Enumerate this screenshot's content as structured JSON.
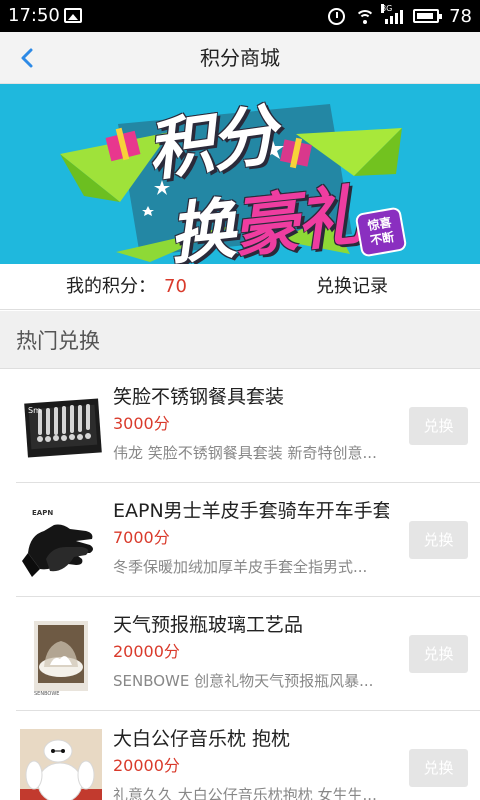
{
  "status_bar": {
    "time": "17:50",
    "signal_tag": "3G",
    "battery_percent": "78"
  },
  "nav": {
    "title": "积分商城"
  },
  "banner": {
    "line1": "积分",
    "line2_a": "换",
    "line2_b": "豪礼",
    "badge_line1": "惊喜",
    "badge_line2": "不断"
  },
  "points": {
    "label": "我的积分：",
    "value": "70",
    "record_link": "兑换记录"
  },
  "section": {
    "title": "热门兑换"
  },
  "items": [
    {
      "name": "笑脸不锈钢餐具套装",
      "price": "3000分",
      "desc": "伟龙 笑脸不锈钢餐具套装 新奇特创意...",
      "button": "兑换",
      "thumb_icon": "cutlery-set-image"
    },
    {
      "name": "EAPN男士羊皮手套骑车开车手套",
      "price": "7000分",
      "desc": "冬季保暖加绒加厚羊皮手套全指男式...",
      "button": "兑换",
      "thumb_icon": "leather-gloves-image",
      "thumb_brand": "EAPN"
    },
    {
      "name": "天气预报瓶玻璃工艺品",
      "price": "20000分",
      "desc": "SENBOWE 创意礼物天气预报瓶风暴...",
      "button": "兑换",
      "thumb_icon": "storm-glass-image",
      "thumb_brand": "SENBOWE"
    },
    {
      "name": "大白公仔音乐枕 抱枕",
      "price": "20000分",
      "desc": "礼意久久 大白公仔音乐枕抱枕 女生生...",
      "button": "兑换",
      "thumb_icon": "baymax-pillow-image"
    }
  ],
  "colors": {
    "accent_red": "#d93a2b",
    "nav_back_blue": "#2d8ae6",
    "banner_bg": "#1fb8dd",
    "button_disabled": "#e5e5e5"
  }
}
